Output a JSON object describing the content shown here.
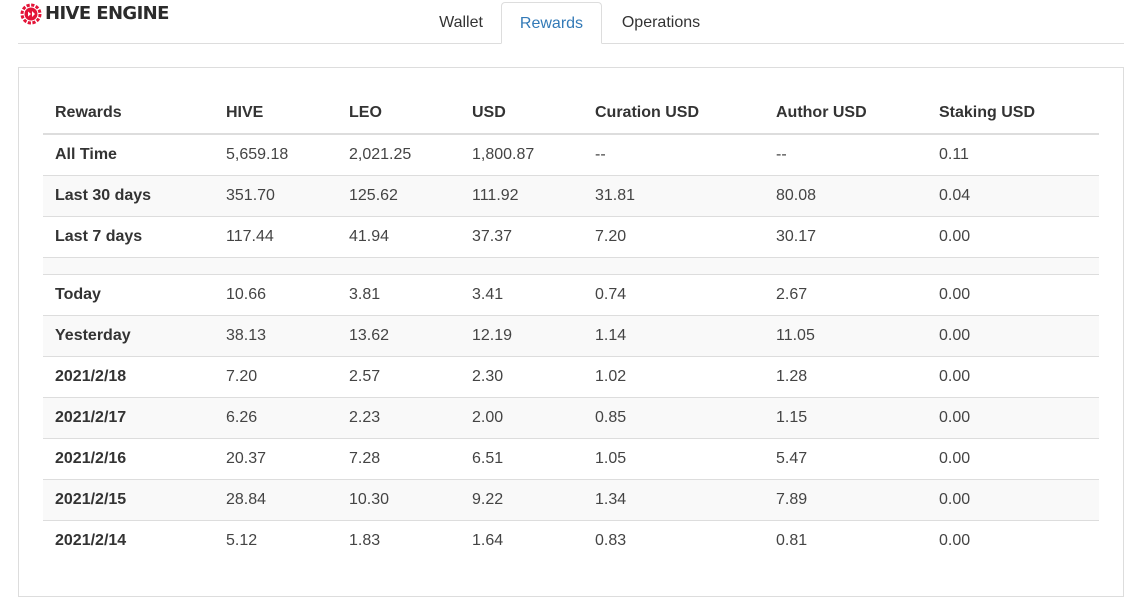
{
  "brand": {
    "name": "HIVE ENGINE",
    "logo_icon": "hive-engine-gear-icon",
    "accent": "#e31337"
  },
  "tabs": [
    {
      "label": "Wallet",
      "active": false
    },
    {
      "label": "Rewards",
      "active": true
    },
    {
      "label": "Operations",
      "active": false
    }
  ],
  "table": {
    "headers": [
      "Rewards",
      "HIVE",
      "LEO",
      "USD",
      "Curation USD",
      "Author USD",
      "Staking USD"
    ],
    "summary": [
      [
        "All Time",
        "5,659.18",
        "2,021.25",
        "1,800.87",
        "--",
        "--",
        "0.11"
      ],
      [
        "Last 30 days",
        "351.70",
        "125.62",
        "111.92",
        "31.81",
        "80.08",
        "0.04"
      ],
      [
        "Last 7 days",
        "117.44",
        "41.94",
        "37.37",
        "7.20",
        "30.17",
        "0.00"
      ]
    ],
    "daily": [
      [
        "Today",
        "10.66",
        "3.81",
        "3.41",
        "0.74",
        "2.67",
        "0.00"
      ],
      [
        "Yesterday",
        "38.13",
        "13.62",
        "12.19",
        "1.14",
        "11.05",
        "0.00"
      ],
      [
        "2021/2/18",
        "7.20",
        "2.57",
        "2.30",
        "1.02",
        "1.28",
        "0.00"
      ],
      [
        "2021/2/17",
        "6.26",
        "2.23",
        "2.00",
        "0.85",
        "1.15",
        "0.00"
      ],
      [
        "2021/2/16",
        "20.37",
        "7.28",
        "6.51",
        "1.05",
        "5.47",
        "0.00"
      ],
      [
        "2021/2/15",
        "28.84",
        "10.30",
        "9.22",
        "1.34",
        "7.89",
        "0.00"
      ],
      [
        "2021/2/14",
        "5.12",
        "1.83",
        "1.64",
        "0.83",
        "0.81",
        "0.00"
      ]
    ]
  },
  "colors": {
    "active_tab": "#337ab7",
    "stripe": "#f9f9f9",
    "border": "#dddddd"
  }
}
